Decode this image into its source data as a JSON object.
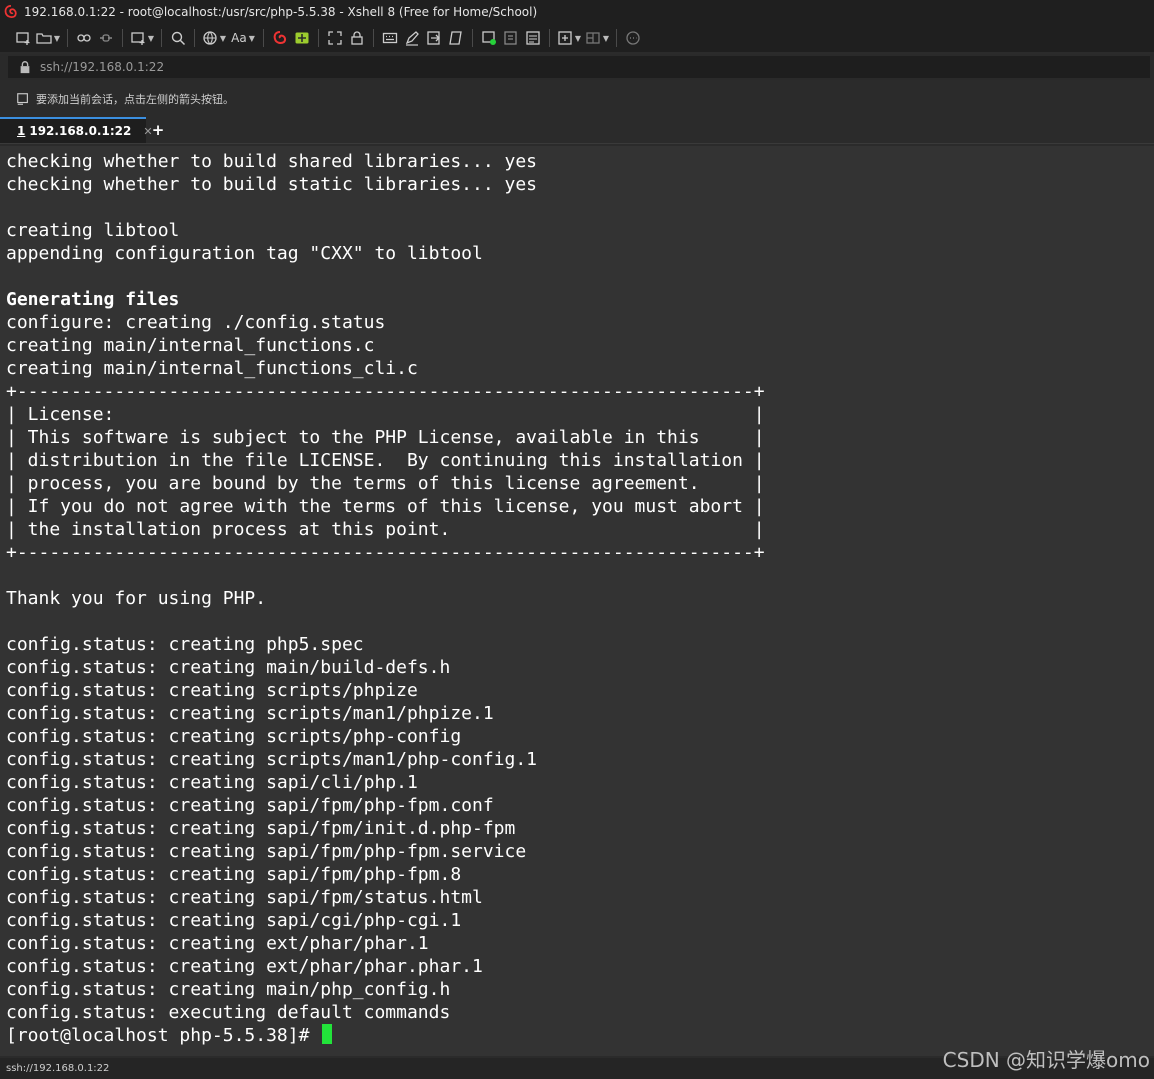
{
  "window": {
    "title": "192.168.0.1:22 - root@localhost:/usr/src/php-5.5.38 - Xshell 8 (Free for Home/School)"
  },
  "toolbar": {
    "font_label": "Aa"
  },
  "address_bar": {
    "url": "ssh://192.168.0.1:22"
  },
  "hint_bar": {
    "text": "要添加当前会话，点击左侧的箭头按钮。"
  },
  "tabs": [
    {
      "number": "1",
      "label": "192.168.0.1:22",
      "active": true,
      "connected_color": "#26d13a"
    }
  ],
  "terminal": {
    "lines": [
      "checking whether to build shared libraries... yes",
      "checking whether to build static libraries... yes",
      "",
      "creating libtool",
      "appending configuration tag \"CXX\" to libtool",
      "",
      "Generating files",
      "configure: creating ./config.status",
      "creating main/internal_functions.c",
      "creating main/internal_functions_cli.c",
      "+--------------------------------------------------------------------+",
      "| License:                                                           |",
      "| This software is subject to the PHP License, available in this     |",
      "| distribution in the file LICENSE.  By continuing this installation |",
      "| process, you are bound by the terms of this license agreement.     |",
      "| If you do not agree with the terms of this license, you must abort |",
      "| the installation process at this point.                            |",
      "+--------------------------------------------------------------------+",
      "",
      "Thank you for using PHP.",
      "",
      "config.status: creating php5.spec",
      "config.status: creating main/build-defs.h",
      "config.status: creating scripts/phpize",
      "config.status: creating scripts/man1/phpize.1",
      "config.status: creating scripts/php-config",
      "config.status: creating scripts/man1/php-config.1",
      "config.status: creating sapi/cli/php.1",
      "config.status: creating sapi/fpm/php-fpm.conf",
      "config.status: creating sapi/fpm/init.d.php-fpm",
      "config.status: creating sapi/fpm/php-fpm.service",
      "config.status: creating sapi/fpm/php-fpm.8",
      "config.status: creating sapi/fpm/status.html",
      "config.status: creating sapi/cgi/php-cgi.1",
      "config.status: creating ext/phar/phar.1",
      "config.status: creating ext/phar/phar.phar.1",
      "config.status: creating main/php_config.h",
      "config.status: executing default commands"
    ],
    "bold_line_index": 6,
    "prompt": "[root@localhost php-5.5.38]# ",
    "cursor_color": "#22e33a"
  },
  "status_bar": {
    "text": "ssh://192.168.0.1:22"
  },
  "watermark": "CSDN @知识学爆omo"
}
